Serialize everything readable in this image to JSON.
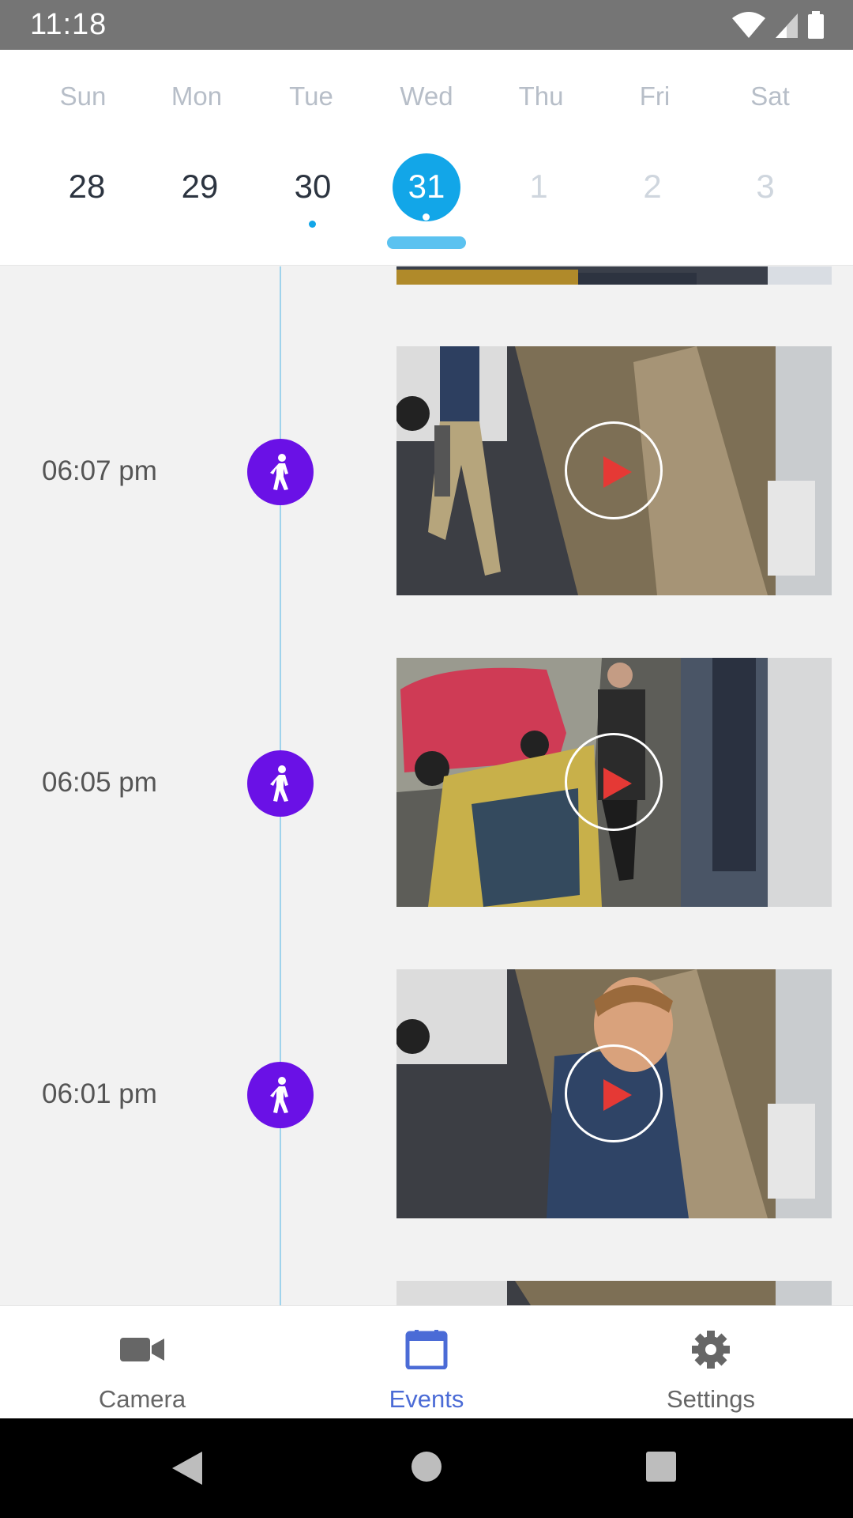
{
  "status_bar": {
    "time": "11:18"
  },
  "calendar": {
    "weekdays": [
      "Sun",
      "Mon",
      "Tue",
      "Wed",
      "Thu",
      "Fri",
      "Sat"
    ],
    "dates": [
      {
        "day": "28",
        "state": "past"
      },
      {
        "day": "29",
        "state": "past"
      },
      {
        "day": "30",
        "state": "past-has-events"
      },
      {
        "day": "31",
        "state": "selected"
      },
      {
        "day": "1",
        "state": "future"
      },
      {
        "day": "2",
        "state": "future"
      },
      {
        "day": "3",
        "state": "future"
      }
    ],
    "accent_color": "#12a6e8"
  },
  "events": [
    {
      "time": "06:07 pm",
      "icon": "person-walking-icon"
    },
    {
      "time": "06:05 pm",
      "icon": "person-walking-icon"
    },
    {
      "time": "06:01 pm",
      "icon": "person-walking-icon"
    }
  ],
  "event_marker_color": "#6a11e6",
  "bottom_nav": {
    "items": [
      {
        "label": "Camera",
        "icon": "video-camera-icon",
        "active": false
      },
      {
        "label": "Events",
        "icon": "calendar-icon",
        "active": true
      },
      {
        "label": "Settings",
        "icon": "gear-icon",
        "active": false
      }
    ],
    "active_color": "#4b6bd6"
  }
}
